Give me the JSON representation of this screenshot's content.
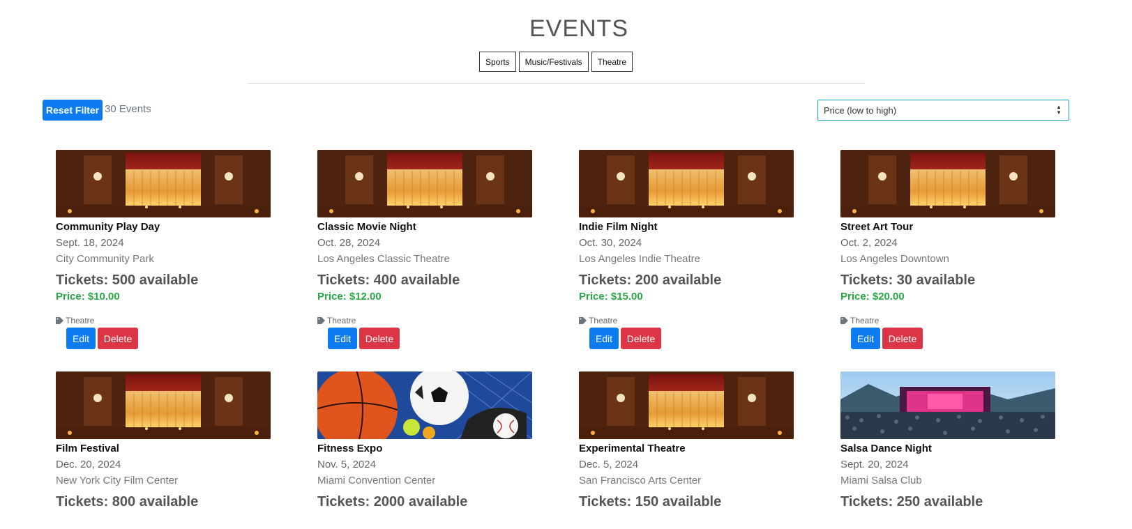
{
  "page": {
    "title": "EVENTS"
  },
  "categories": [
    "Sports",
    "Music/Festivals",
    "Theatre"
  ],
  "filter": {
    "reset_label": "Reset Filter",
    "count_text": "30 Events"
  },
  "sort": {
    "selected": "Price (low to high)"
  },
  "events": [
    {
      "title": "Community Play Day",
      "date": "Sept. 18, 2024",
      "venue": "City Community Park",
      "tickets": "Tickets: 500 available",
      "price": "Price: $10.00",
      "tag": "Theatre",
      "image": "theatre-stage",
      "edit": "Edit",
      "delete": "Delete"
    },
    {
      "title": "Classic Movie Night",
      "date": "Oct. 28, 2024",
      "venue": "Los Angeles Classic Theatre",
      "tickets": "Tickets: 400 available",
      "price": "Price: $12.00",
      "tag": "Theatre",
      "image": "theatre-stage",
      "edit": "Edit",
      "delete": "Delete"
    },
    {
      "title": "Indie Film Night",
      "date": "Oct. 30, 2024",
      "venue": "Los Angeles Indie Theatre",
      "tickets": "Tickets: 200 available",
      "price": "Price: $15.00",
      "tag": "Theatre",
      "image": "theatre-stage",
      "edit": "Edit",
      "delete": "Delete"
    },
    {
      "title": "Street Art Tour",
      "date": "Oct. 2, 2024",
      "venue": "Los Angeles Downtown",
      "tickets": "Tickets: 30 available",
      "price": "Price: $20.00",
      "tag": "Theatre",
      "image": "theatre-stage",
      "edit": "Edit",
      "delete": "Delete"
    },
    {
      "title": "Film Festival",
      "date": "Dec. 20, 2024",
      "venue": "New York City Film Center",
      "tickets": "Tickets: 800 available",
      "image": "theatre-stage"
    },
    {
      "title": "Fitness Expo",
      "date": "Nov. 5, 2024",
      "venue": "Miami Convention Center",
      "tickets": "Tickets: 2000 available",
      "image": "sports-balls"
    },
    {
      "title": "Experimental Theatre",
      "date": "Dec. 5, 2024",
      "venue": "San Francisco Arts Center",
      "tickets": "Tickets: 150 available",
      "image": "theatre-stage"
    },
    {
      "title": "Salsa Dance Night",
      "date": "Sept. 20, 2024",
      "venue": "Miami Salsa Club",
      "tickets": "Tickets: 250 available",
      "image": "festival-crowd"
    }
  ]
}
